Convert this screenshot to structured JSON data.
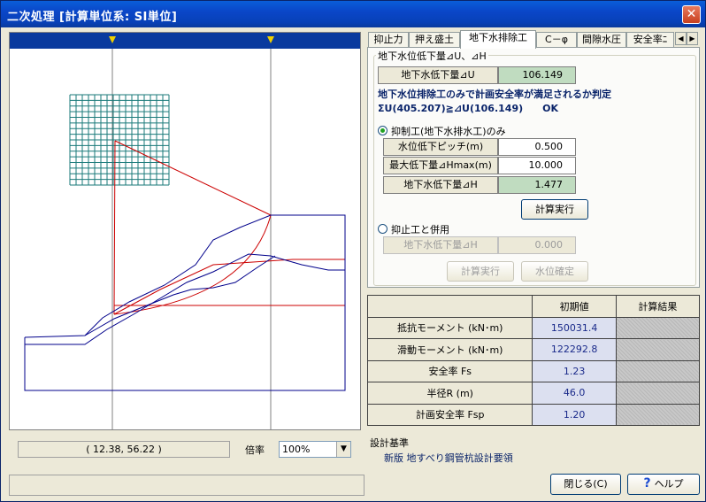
{
  "window": {
    "title": "二次処理 [計算単位系: SI単位]",
    "close_glyph": "✕"
  },
  "canvas": {
    "coord_readout": "( 12.38,  56.22 )",
    "zoom_label": "倍率",
    "zoom_value": "100%"
  },
  "tabs": [
    {
      "label": "抑止力"
    },
    {
      "label": "押え盛土"
    },
    {
      "label": "地下水排除工"
    },
    {
      "label": "C－φ"
    },
    {
      "label": "間隙水圧"
    },
    {
      "label": "安全率ﾆ"
    }
  ],
  "tab_scroll": {
    "left": "◀",
    "right": "▶"
  },
  "groundwater": {
    "group_title": "地下水位低下量⊿U、⊿H",
    "du_label": "地下水低下量⊿U",
    "du_value": "106.149",
    "judge_line1": "地下水位排除工のみで計画安全率が満足されるか判定",
    "judge_line2": "ΣU(405.207)≧⊿U(106.149)　　OK",
    "option1_label": "抑制工(地下水排水工)のみ",
    "pitch_label": "水位低下ピッチ(m)",
    "pitch_value": "0.500",
    "hmax_label": "最大低下量⊿Hmax(m)",
    "hmax_value": "10.000",
    "dh_label": "地下水低下量⊿H",
    "dh_value": "1.477",
    "calc_button": "計算実行",
    "option2_label": "抑止工と併用",
    "dh2_label": "地下水低下量⊿H",
    "dh2_value": "0.000",
    "calc2_button": "計算実行",
    "confirm_button": "水位確定"
  },
  "results": {
    "headers": [
      "",
      "初期値",
      "計算結果"
    ],
    "rows": [
      {
        "name": "抵抗モーメント (kN･m)",
        "init": "150031.4"
      },
      {
        "name": "滑動モーメント (kN･m)",
        "init": "122292.8"
      },
      {
        "name": "安全率 Fs",
        "init": "1.23"
      },
      {
        "name": "半径R (m)",
        "init": "46.0"
      },
      {
        "name": "計画安全率 Fsp",
        "init": "1.20"
      }
    ]
  },
  "standard": {
    "title": "設計基準",
    "value": "新版 地すべり鋼管杭設計要領"
  },
  "buttons": {
    "close": "閉じる(C)",
    "help": "ヘルプ",
    "help_icon": "?"
  },
  "colors": {
    "title_bar": "#0a46c8",
    "green_value": "#c0dcc0",
    "grid": "#1a7a7a",
    "slip_circle": "#cc0000",
    "ground_line": "#00008b"
  }
}
